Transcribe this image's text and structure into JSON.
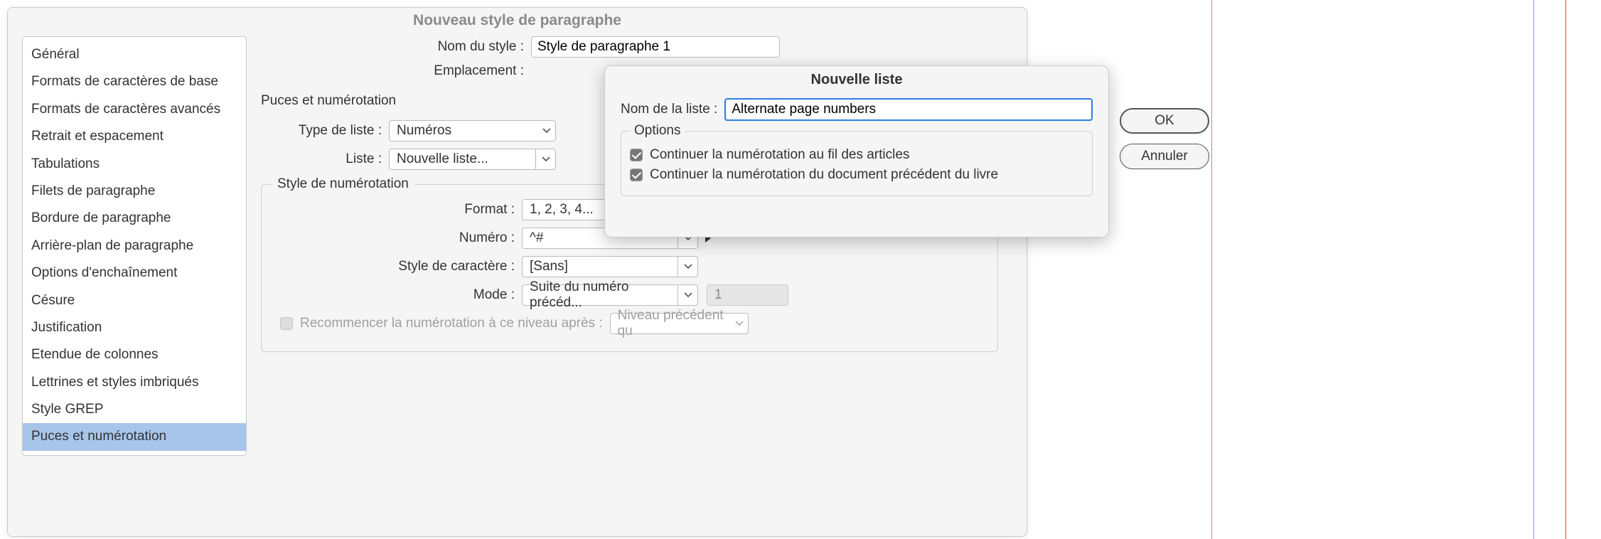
{
  "dialog": {
    "title": "Nouveau style de paragraphe",
    "style_name_label": "Nom du style :",
    "style_name_value": "Style de paragraphe 1",
    "emplacement_label": "Emplacement :"
  },
  "sidebar": {
    "items": [
      "Général",
      "Formats de caractères de base",
      "Formats de caractères avancés",
      "Retrait et espacement",
      "Tabulations",
      "Filets de paragraphe",
      "Bordure de paragraphe",
      "Arrière-plan de paragraphe",
      "Options d'enchaînement",
      "Césure",
      "Justification",
      "Etendue de colonnes",
      "Lettrines et styles imbriqués",
      "Style GREP",
      "Puces et numérotation"
    ],
    "selected_index": 14
  },
  "section": {
    "header": "Puces et numérotation",
    "type_label": "Type de liste :",
    "type_value": "Numéros",
    "liste_label": "Liste :",
    "liste_value": "Nouvelle liste..."
  },
  "numbering": {
    "legend": "Style de numérotation",
    "format_label": "Format :",
    "format_value": "1, 2, 3, 4...",
    "numero_label": "Numéro :",
    "numero_value": "^#",
    "charstyle_label": "Style de caractère :",
    "charstyle_value": "[Sans]",
    "mode_label": "Mode :",
    "mode_value": "Suite du numéro précéd...",
    "mode_num": "1",
    "restart_label": "Recommencer la numérotation à ce niveau après :",
    "restart_value": "Niveau précédent qu"
  },
  "newlist": {
    "title": "Nouvelle liste",
    "name_label": "Nom de la liste :",
    "name_value": "Alternate page numbers",
    "options_legend": "Options",
    "opt1": "Continuer la numérotation au fil des articles",
    "opt2": "Continuer la numérotation du document précédent du livre",
    "ok": "OK",
    "cancel": "Annuler"
  }
}
